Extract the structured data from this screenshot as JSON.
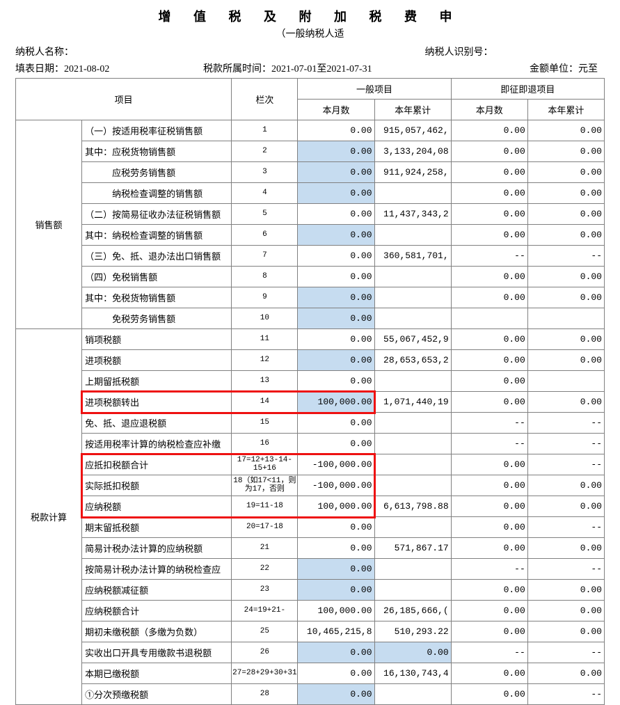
{
  "title": "增 值 税 及 附 加 税 费 申",
  "subtitle": "（一般纳税人适",
  "meta": {
    "name_lbl": "纳税人名称：",
    "id_lbl": "纳税人识别号：",
    "fill_date_lbl": "填表日期：",
    "fill_date": "2021-08-02",
    "period_lbl": "税款所属时间：",
    "period": "2021-07-01至2021-07-31",
    "unit_lbl": "金额单位：元至"
  },
  "hdr": {
    "xm": "项目",
    "lc": "栏次",
    "yb": "一般项目",
    "jz": "即征即退项目",
    "bys": "本月数",
    "bnlj": "本年累计"
  },
  "cat": {
    "sales": "销售额",
    "tax": "税款计算"
  },
  "rows": [
    {
      "cat": "sales",
      "lbl": "（一）按适用税率征税销售额",
      "col": "1",
      "a": {
        "t": "p",
        "v": "0.00"
      },
      "b": "915,057,462,",
      "c": "0.00",
      "d": "0.00"
    },
    {
      "cat": "sales",
      "lbl": "其中：应税货物销售额",
      "col": "2",
      "a": {
        "t": "i",
        "v": "0.00"
      },
      "b": "3,133,204,08",
      "c": "0.00",
      "d": "0.00"
    },
    {
      "cat": "sales",
      "lbl": "　　　应税劳务销售额",
      "col": "3",
      "a": {
        "t": "i",
        "v": "0.00"
      },
      "b": "911,924,258,",
      "c": "0.00",
      "d": "0.00"
    },
    {
      "cat": "sales",
      "lbl": "　　　纳税检查调整的销售额",
      "col": "4",
      "a": {
        "t": "i",
        "v": "0.00"
      },
      "b": "",
      "c": "0.00",
      "d": "0.00"
    },
    {
      "cat": "sales",
      "lbl": "（二）按简易征收办法征税销售额",
      "col": "5",
      "a": {
        "t": "p",
        "v": "0.00"
      },
      "b": "11,437,343,2",
      "c": "0.00",
      "d": "0.00"
    },
    {
      "cat": "sales",
      "lbl": "其中：纳税检查调整的销售额",
      "col": "6",
      "a": {
        "t": "i",
        "v": "0.00"
      },
      "b": "",
      "c": "0.00",
      "d": "0.00"
    },
    {
      "cat": "sales",
      "lbl": "（三）免、抵、退办法出口销售额",
      "col": "7",
      "a": {
        "t": "p",
        "v": "0.00"
      },
      "b": "360,581,701,",
      "c": "--",
      "d": "--"
    },
    {
      "cat": "sales",
      "lbl": "（四）免税销售额",
      "col": "8",
      "a": {
        "t": "p",
        "v": "0.00"
      },
      "b": "",
      "c": "0.00",
      "d": "0.00"
    },
    {
      "cat": "sales",
      "lbl": "其中：免税货物销售额",
      "col": "9",
      "a": {
        "t": "i",
        "v": "0.00"
      },
      "b": "",
      "c": "0.00",
      "d": "0.00"
    },
    {
      "cat": "sales",
      "lbl": "　　　免税劳务销售额",
      "col": "10",
      "a": {
        "t": "i",
        "v": "0.00"
      },
      "b": "",
      "c": "",
      "d": ""
    },
    {
      "cat": "tax",
      "lbl": "销项税额",
      "col": "11",
      "a": {
        "t": "p",
        "v": "0.00"
      },
      "b": "55,067,452,9",
      "c": "0.00",
      "d": "0.00"
    },
    {
      "cat": "tax",
      "lbl": "进项税额",
      "col": "12",
      "a": {
        "t": "i",
        "v": "0.00"
      },
      "b": "28,653,653,2",
      "c": "0.00",
      "d": "0.00"
    },
    {
      "cat": "tax",
      "lbl": "上期留抵税额",
      "col": "13",
      "a": {
        "t": "p",
        "v": "0.00"
      },
      "b": "",
      "c": "0.00",
      "d": ""
    },
    {
      "cat": "tax",
      "lbl": "进项税额转出",
      "col": "14",
      "a": {
        "t": "i",
        "v": "100,000.00"
      },
      "b": "1,071,440,19",
      "c": "0.00",
      "d": "0.00",
      "hl": "row14"
    },
    {
      "cat": "tax",
      "lbl": "免、抵、退应退税额",
      "col": "15",
      "a": {
        "t": "p",
        "v": "0.00"
      },
      "b": "",
      "c": "--",
      "d": "--"
    },
    {
      "cat": "tax",
      "lbl": "按适用税率计算的纳税检查应补缴",
      "col": "16",
      "a": {
        "t": "p",
        "v": "0.00"
      },
      "b": "",
      "c": "--",
      "d": "--"
    },
    {
      "cat": "tax",
      "lbl": "应抵扣税额合计",
      "col": "17=12+13-14-15+16",
      "a": {
        "t": "p",
        "v": "-100,000.00"
      },
      "b": "",
      "c": "0.00",
      "d": "--",
      "hl": "blk"
    },
    {
      "cat": "tax",
      "lbl": "实际抵扣税额",
      "col": "18（如17<11，则为17，否则",
      "a": {
        "t": "p",
        "v": "-100,000.00"
      },
      "b": "",
      "c": "0.00",
      "d": "0.00",
      "hl": "blk"
    },
    {
      "cat": "tax",
      "lbl": "应纳税额",
      "col": "19=11-18",
      "a": {
        "t": "p",
        "v": "100,000.00"
      },
      "b": "6,613,798.88",
      "c": "0.00",
      "d": "0.00",
      "hl": "blk"
    },
    {
      "cat": "tax",
      "lbl": "期末留抵税额",
      "col": "20=17-18",
      "a": {
        "t": "p",
        "v": "0.00"
      },
      "b": "",
      "c": "0.00",
      "d": "--"
    },
    {
      "cat": "tax",
      "lbl": "简易计税办法计算的应纳税额",
      "col": "21",
      "a": {
        "t": "p",
        "v": "0.00"
      },
      "b": "571,867.17",
      "c": "0.00",
      "d": "0.00"
    },
    {
      "cat": "tax",
      "lbl": "按简易计税办法计算的纳税检查应",
      "col": "22",
      "a": {
        "t": "i",
        "v": "0.00"
      },
      "b": "",
      "c": "--",
      "d": "--"
    },
    {
      "cat": "tax",
      "lbl": "应纳税额减征额",
      "col": "23",
      "a": {
        "t": "i",
        "v": "0.00"
      },
      "b": "",
      "c": "0.00",
      "d": "0.00"
    },
    {
      "cat": "tax",
      "lbl": "应纳税额合计",
      "col": "24=19+21-",
      "a": {
        "t": "p",
        "v": "100,000.00"
      },
      "b": "26,185,666,(",
      "c": "0.00",
      "d": "0.00"
    },
    {
      "cat": "tax",
      "lbl": "期初未缴税额（多缴为负数）",
      "col": "25",
      "a": {
        "t": "p",
        "v": "10,465,215,8"
      },
      "b": "510,293.22",
      "c": "0.00",
      "d": "0.00"
    },
    {
      "cat": "tax",
      "lbl": "实收出口开具专用缴款书退税额",
      "col": "26",
      "a": {
        "t": "i",
        "v": "0.00"
      },
      "b": {
        "t": "i",
        "v": "0.00"
      },
      "c": "--",
      "d": "--"
    },
    {
      "cat": "tax",
      "lbl": "本期已缴税额",
      "col": "27=28+29+30+31",
      "a": {
        "t": "p",
        "v": "0.00"
      },
      "b": "16,130,743,4",
      "c": "0.00",
      "d": "0.00"
    },
    {
      "cat": "tax",
      "lbl": "①分次预缴税额",
      "col": "28",
      "a": {
        "t": "i",
        "v": "0.00"
      },
      "b": "",
      "c": "0.00",
      "d": "--"
    }
  ]
}
